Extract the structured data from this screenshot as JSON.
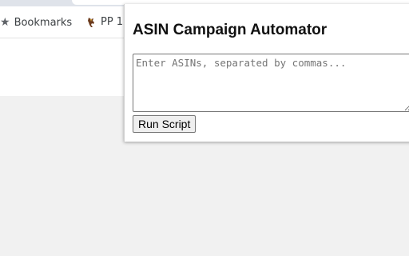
{
  "browser": {
    "bookmarks": [
      {
        "label": "Bookmarks",
        "icon": "star-icon"
      },
      {
        "label": "PP 1",
        "icon": "horse-icon"
      }
    ]
  },
  "popup": {
    "title": "ASIN Campaign Automator",
    "asin_input": {
      "value": "",
      "placeholder": "Enter ASINs, separated by commas..."
    },
    "run_label": "Run Script"
  }
}
